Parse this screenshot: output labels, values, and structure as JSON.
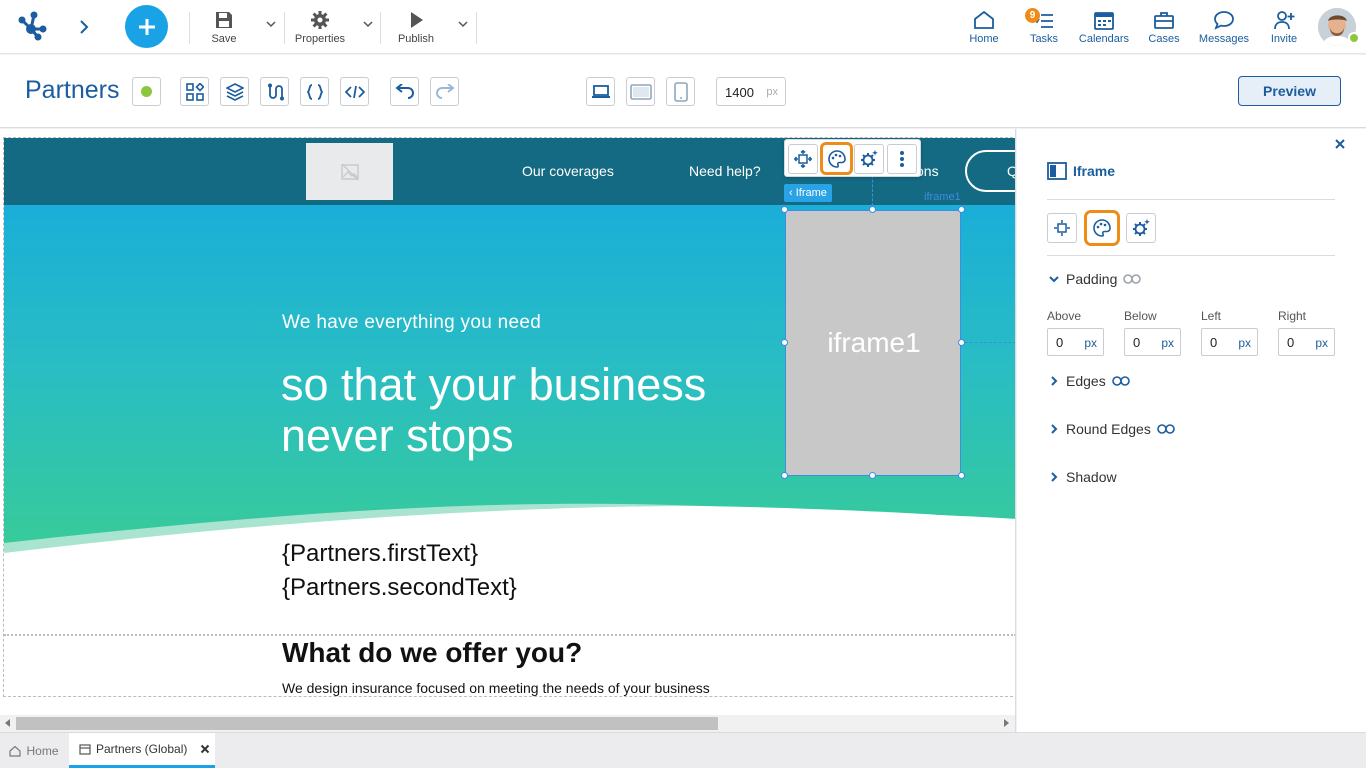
{
  "colors": {
    "accent": "#1b5d9e",
    "plus": "#1aa2e6",
    "orange": "#ee8c1a",
    "status": "#8dc73f",
    "header": "#136a82"
  },
  "topbar": {
    "save_label": "Save",
    "properties_label": "Properties",
    "publish_label": "Publish",
    "nav": [
      {
        "label": "Home",
        "icon": "home-icon"
      },
      {
        "label": "Tasks",
        "icon": "tasks-icon",
        "badge": "9"
      },
      {
        "label": "Calendars",
        "icon": "calendar-icon"
      },
      {
        "label": "Cases",
        "icon": "briefcase-icon"
      },
      {
        "label": "Messages",
        "icon": "chat-icon"
      },
      {
        "label": "Invite",
        "icon": "invite-icon"
      }
    ]
  },
  "toolbar": {
    "title": "Partners",
    "width_value": "1400",
    "width_unit": "px",
    "preview_label": "Preview"
  },
  "canvas": {
    "nav_links": [
      "Our coverages",
      "Need help?"
    ],
    "nav_partial": "ons",
    "hero_small": "We have everything you need",
    "hero_big_1": "so that your business",
    "hero_big_2": "never stops",
    "iframe_text": "iframe1",
    "iframe_tag": "Iframe",
    "iframe_name": "iframe1",
    "var_1": "{Partners.firstText}",
    "var_2": "{Partners.secondText}",
    "offer_title": "What do we offer you?",
    "offer_text": "We design insurance focused on meeting the needs of your business"
  },
  "panel": {
    "title": "Iframe",
    "padding_label": "Padding",
    "fields": [
      {
        "label": "Above",
        "value": "0",
        "unit": "px"
      },
      {
        "label": "Below",
        "value": "0",
        "unit": "px"
      },
      {
        "label": "Left",
        "value": "0",
        "unit": "px"
      },
      {
        "label": "Right",
        "value": "0",
        "unit": "px"
      }
    ],
    "edges_label": "Edges",
    "round_label": "Round Edges",
    "shadow_label": "Shadow"
  },
  "tabs": {
    "home": "Home",
    "current": "Partners (Global)"
  }
}
